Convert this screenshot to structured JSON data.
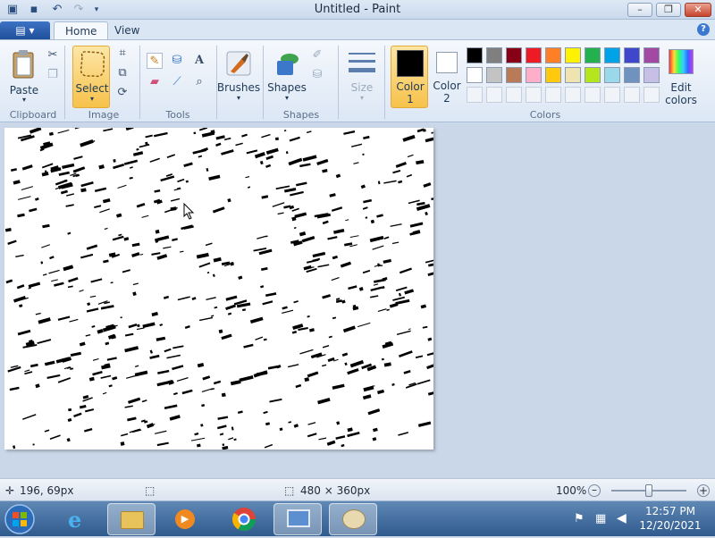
{
  "window": {
    "title": "Untitled - Paint"
  },
  "tabs": [
    {
      "label": "Home"
    },
    {
      "label": "View"
    }
  ],
  "ribbon": {
    "clipboard": {
      "paste_label": "Paste",
      "group_label": "Clipboard"
    },
    "image": {
      "select_label": "Select",
      "group_label": "Image"
    },
    "tools": {
      "group_label": "Tools"
    },
    "brushes": {
      "label": "Brushes"
    },
    "shapes": {
      "label": "Shapes",
      "group_label": "Shapes"
    },
    "size": {
      "label": "Size"
    },
    "colors": {
      "color1_label": "Color\n1",
      "color1_line1": "Color",
      "color1_line2": "1",
      "color2_line1": "Color",
      "color2_line2": "2",
      "color1_value": "#000000",
      "color2_value": "#ffffff",
      "edit_line1": "Edit",
      "edit_line2": "colors",
      "group_label": "Colors",
      "palette_row1": [
        "#000000",
        "#7f7f7f",
        "#880015",
        "#ed1c24",
        "#ff7f27",
        "#fff200",
        "#22b14c",
        "#00a2e8",
        "#3f48cc",
        "#a349a4"
      ],
      "palette_row2": [
        "#ffffff",
        "#c3c3c3",
        "#b97a57",
        "#ffaec9",
        "#ffc90e",
        "#efe4b0",
        "#b5e61d",
        "#99d9ea",
        "#7092be",
        "#c8bfe7"
      ]
    }
  },
  "status": {
    "cursor_pos": "196, 69px",
    "canvas_size": "480 × 360px",
    "zoom": "100%",
    "zoom_level": 1.0
  },
  "taskbar": {
    "time": "12:57 PM",
    "date": "12/20/2021"
  },
  "icons": {
    "app_menu": "app-menu-icon",
    "save": "save-icon",
    "undo": "undo-icon",
    "redo": "redo-icon"
  }
}
